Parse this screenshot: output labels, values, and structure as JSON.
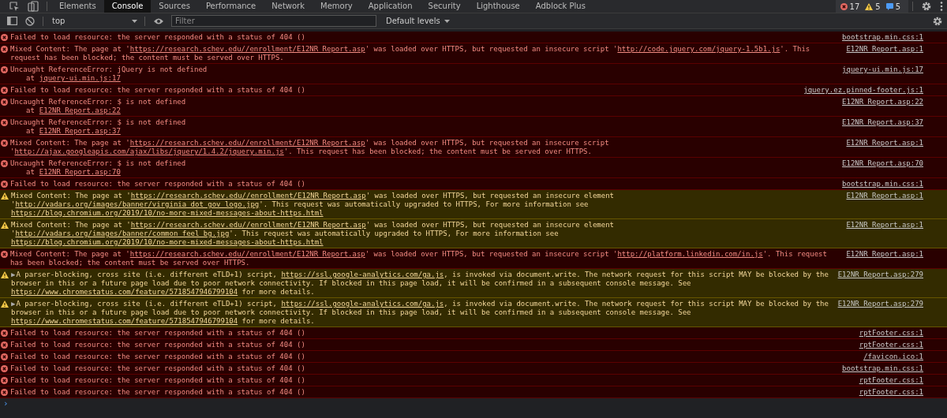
{
  "tabs": [
    {
      "label": "Elements",
      "selected": false
    },
    {
      "label": "Console",
      "selected": true
    },
    {
      "label": "Sources",
      "selected": false
    },
    {
      "label": "Performance",
      "selected": false
    },
    {
      "label": "Network",
      "selected": false
    },
    {
      "label": "Memory",
      "selected": false
    },
    {
      "label": "Application",
      "selected": false
    },
    {
      "label": "Security",
      "selected": false
    },
    {
      "label": "Lighthouse",
      "selected": false
    },
    {
      "label": "Adblock Plus",
      "selected": false
    }
  ],
  "counts": [
    {
      "kind": "error",
      "text": "17"
    },
    {
      "kind": "warning",
      "text": "5"
    },
    {
      "kind": "info",
      "text": "5"
    }
  ],
  "toolbar": {
    "context": "top",
    "filter": {
      "placeholder": "Filter"
    },
    "levels": "Default levels"
  },
  "messages": [
    {
      "kind": "error",
      "parts": [
        {
          "kind": "text",
          "text": "Failed to load resource: the server responded with a status of 404 ()"
        }
      ],
      "source": "bootstrap.min.css:1"
    },
    {
      "kind": "error",
      "parts": [
        {
          "kind": "text",
          "text": "Mixed Content: The page at '"
        },
        {
          "kind": "link",
          "text": "https://research.schev.edu//enrollment/E12NR Report.asp"
        },
        {
          "kind": "text",
          "text": "' was loaded over HTTPS, but requested an insecure script '"
        },
        {
          "kind": "link",
          "text": "http://code.jquery.com/jquery-1.5b1.js"
        },
        {
          "kind": "text",
          "text": "'. This request has been blocked; the content must be served over HTTPS."
        }
      ],
      "source": "E12NR Report.asp:1"
    },
    {
      "kind": "error",
      "parts": [
        {
          "kind": "text",
          "text": "Uncaught ReferenceError: jQuery is not defined"
        }
      ],
      "stack": {
        "prefix": "at",
        "link": "jquery-ui.min.js:17"
      },
      "source": "jquery-ui.min.js:17"
    },
    {
      "kind": "error",
      "parts": [
        {
          "kind": "text",
          "text": "Failed to load resource: the server responded with a status of 404 ()"
        }
      ],
      "source": "jquery.ez.pinned-footer.js:1"
    },
    {
      "kind": "error",
      "parts": [
        {
          "kind": "text",
          "text": "Uncaught ReferenceError: $ is not defined"
        }
      ],
      "stack": {
        "prefix": "at",
        "link": "E12NR Report.asp:22"
      },
      "source": "E12NR Report.asp:22"
    },
    {
      "kind": "error",
      "parts": [
        {
          "kind": "text",
          "text": "Uncaught ReferenceError: $ is not defined"
        }
      ],
      "stack": {
        "prefix": "at",
        "link": "E12NR Report.asp:37"
      },
      "source": "E12NR Report.asp:37"
    },
    {
      "kind": "error",
      "parts": [
        {
          "kind": "text",
          "text": "Mixed Content: The page at '"
        },
        {
          "kind": "link",
          "text": "https://research.schev.edu//enrollment/E12NR Report.asp"
        },
        {
          "kind": "text",
          "text": "' was loaded over HTTPS, but requested an insecure script '"
        },
        {
          "kind": "link",
          "text": "http://ajax.googleapis.com/ajax/libs/jquery/1.4.2/jquery.min.js"
        },
        {
          "kind": "text",
          "text": "'. This request has been blocked; the content must be served over HTTPS."
        }
      ],
      "source": "E12NR Report.asp:1"
    },
    {
      "kind": "error",
      "parts": [
        {
          "kind": "text",
          "text": "Uncaught ReferenceError: $ is not defined"
        }
      ],
      "stack": {
        "prefix": "at",
        "link": "E12NR Report.asp:70"
      },
      "source": "E12NR Report.asp:70"
    },
    {
      "kind": "error",
      "parts": [
        {
          "kind": "text",
          "text": "Failed to load resource: the server responded with a status of 404 ()"
        }
      ],
      "source": "bootstrap.min.css:1"
    },
    {
      "kind": "warning",
      "parts": [
        {
          "kind": "text",
          "text": "Mixed Content: The page at '"
        },
        {
          "kind": "link",
          "text": "https://research.schev.edu//enrollment/E12NR Report.asp"
        },
        {
          "kind": "text",
          "text": "' was loaded over HTTPS, but requested an insecure element '"
        },
        {
          "kind": "link",
          "text": "http://vadars.org/images/banner/virginia dot gov logo.jpg"
        },
        {
          "kind": "text",
          "text": "'. This request was automatically upgraded to HTTPS, For more information see "
        },
        {
          "kind": "link",
          "text": "https://blog.chromium.org/2019/10/no-more-mixed-messages-about-https.html"
        }
      ],
      "source": "E12NR Report.asp:1"
    },
    {
      "kind": "warning",
      "parts": [
        {
          "kind": "text",
          "text": "Mixed Content: The page at '"
        },
        {
          "kind": "link",
          "text": "https://research.schev.edu//enrollment/E12NR Report.asp"
        },
        {
          "kind": "text",
          "text": "' was loaded over HTTPS, but requested an insecure element '"
        },
        {
          "kind": "link",
          "text": "http://vadars.org/images/banner/common feel bg.jpg"
        },
        {
          "kind": "text",
          "text": "'. This request was automatically upgraded to HTTPS, For more information see "
        },
        {
          "kind": "link",
          "text": "https://blog.chromium.org/2019/10/no-more-mixed-messages-about-https.html"
        }
      ],
      "source": "E12NR Report.asp:1"
    },
    {
      "kind": "error",
      "parts": [
        {
          "kind": "text",
          "text": "Mixed Content: The page at '"
        },
        {
          "kind": "link",
          "text": "https://research.schev.edu//enrollment/E12NR Report.asp"
        },
        {
          "kind": "text",
          "text": "' was loaded over HTTPS, but requested an insecure script '"
        },
        {
          "kind": "link",
          "text": "http://platform.linkedin.com/in.js"
        },
        {
          "kind": "text",
          "text": "'. This request has been blocked; the content must be served over HTTPS."
        }
      ],
      "source": "E12NR Report.asp:1"
    },
    {
      "kind": "warning",
      "expander": "▶",
      "parts": [
        {
          "kind": "text",
          "text": "A parser-blocking, cross site (i.e. different eTLD+1) script, "
        },
        {
          "kind": "link",
          "text": "https://ssl.google-analytics.com/ga.js"
        },
        {
          "kind": "text",
          "text": ", is invoked via document.write. The network request for this script MAY be blocked by the browser in this or a future page load due to poor network connectivity. If blocked in this page load, it will be confirmed in a subsequent console message. See "
        },
        {
          "kind": "link",
          "text": "https://www.chromestatus.com/feature/5718547946799104"
        },
        {
          "kind": "text",
          "text": " for more details."
        }
      ],
      "source": "E12NR Report.asp:279"
    },
    {
      "kind": "warning",
      "expander": "▶",
      "parts": [
        {
          "kind": "text",
          "text": "A parser-blocking, cross site (i.e. different eTLD+1) script, "
        },
        {
          "kind": "link",
          "text": "https://ssl.google-analytics.com/ga.js"
        },
        {
          "kind": "text",
          "text": ", is invoked via document.write. The network request for this script MAY be blocked by the browser in this or a future page load due to poor network connectivity. If blocked in this page load, it will be confirmed in a subsequent console message. See "
        },
        {
          "kind": "link",
          "text": "https://www.chromestatus.com/feature/5718547946799104"
        },
        {
          "kind": "text",
          "text": " for more details."
        }
      ],
      "source": "E12NR Report.asp:279"
    },
    {
      "kind": "error",
      "parts": [
        {
          "kind": "text",
          "text": "Failed to load resource: the server responded with a status of 404 ()"
        }
      ],
      "source": "rptFooter.css:1"
    },
    {
      "kind": "error",
      "parts": [
        {
          "kind": "text",
          "text": "Failed to load resource: the server responded with a status of 404 ()"
        }
      ],
      "source": "rptFooter.css:1"
    },
    {
      "kind": "error",
      "parts": [
        {
          "kind": "text",
          "text": "Failed to load resource: the server responded with a status of 404 ()"
        }
      ],
      "source": "/favicon.ico:1"
    },
    {
      "kind": "error",
      "parts": [
        {
          "kind": "text",
          "text": "Failed to load resource: the server responded with a status of 404 ()"
        }
      ],
      "source": "bootstrap.min.css:1"
    },
    {
      "kind": "error",
      "parts": [
        {
          "kind": "text",
          "text": "Failed to load resource: the server responded with a status of 404 ()"
        }
      ],
      "source": "rptFooter.css:1"
    },
    {
      "kind": "error",
      "parts": [
        {
          "kind": "text",
          "text": "Failed to load resource: the server responded with a status of 404 ()"
        }
      ],
      "source": "rptFooter.css:1"
    }
  ],
  "prompt": "›"
}
